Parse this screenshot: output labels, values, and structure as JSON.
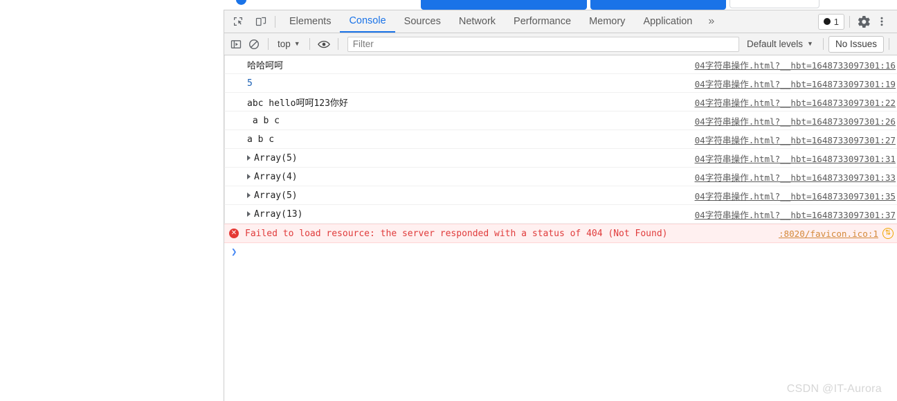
{
  "browser_chrome": {
    "chip_one_glyphs": [
      "✓",
      "✓"
    ],
    "chip_two_glyphs": [],
    "field_glyph": "▭"
  },
  "devtools": {
    "tabs": [
      {
        "label": "Elements",
        "active": false
      },
      {
        "label": "Console",
        "active": true
      },
      {
        "label": "Sources",
        "active": false
      },
      {
        "label": "Network",
        "active": false
      },
      {
        "label": "Performance",
        "active": false
      },
      {
        "label": "Memory",
        "active": false
      },
      {
        "label": "Application",
        "active": false
      }
    ],
    "overflow_label": "»",
    "inspect_icon": "inspect-element-icon",
    "device_icon": "device-toolbar-icon",
    "error_count": "1",
    "gear_icon": "settings-gear-icon",
    "kebab_icon": "more-options-icon"
  },
  "console_toolbar": {
    "sidebar_toggle_icon": "console-sidebar-icon",
    "clear_icon": "clear-console-icon",
    "context": "top",
    "caret": "▼",
    "eye_icon": "live-expression-icon",
    "filter_placeholder": "Filter",
    "filter_value": "",
    "levels_label": "Default levels",
    "no_issues_label": "No Issues"
  },
  "console_messages": [
    {
      "text": "哈哈呵呵",
      "kind": "text",
      "expandable": false,
      "link": "04字符串操作.html?__hbt=1648733097301:16"
    },
    {
      "text": "5",
      "kind": "number",
      "expandable": false,
      "link": "04字符串操作.html?__hbt=1648733097301:19"
    },
    {
      "text": "abc hello呵呵123你好",
      "kind": "text",
      "expandable": false,
      "link": "04字符串操作.html?__hbt=1648733097301:22"
    },
    {
      "text": " a b c",
      "kind": "text",
      "expandable": false,
      "link": "04字符串操作.html?__hbt=1648733097301:26"
    },
    {
      "text": "a b c",
      "kind": "text",
      "expandable": false,
      "link": "04字符串操作.html?__hbt=1648733097301:27"
    },
    {
      "text": "Array(5)",
      "kind": "object",
      "expandable": true,
      "link": "04字符串操作.html?__hbt=1648733097301:31"
    },
    {
      "text": "Array(4)",
      "kind": "object",
      "expandable": true,
      "link": "04字符串操作.html?__hbt=1648733097301:33"
    },
    {
      "text": "Array(5)",
      "kind": "object",
      "expandable": true,
      "link": "04字符串操作.html?__hbt=1648733097301:35"
    },
    {
      "text": "Array(13)",
      "kind": "object",
      "expandable": true,
      "link": "04字符串操作.html?__hbt=1648733097301:37"
    }
  ],
  "error_message": {
    "icon": "error-circle-icon",
    "text": "Failed to load resource: the server responded with a status of 404 (Not Found)",
    "link": ":8020/favicon.ico:1",
    "badge_icon": "network-request-icon",
    "badge_glyph": "⇅"
  },
  "prompt": {
    "caret": "❯",
    "value": ""
  },
  "watermark": "CSDN @IT-Aurora",
  "colors": {
    "accent": "#1a73e8",
    "error": "#e53935",
    "error_bg": "#fff0f0",
    "link": "#5a5a5a",
    "warning": "#f0a500",
    "number": "#1a5fb4"
  }
}
